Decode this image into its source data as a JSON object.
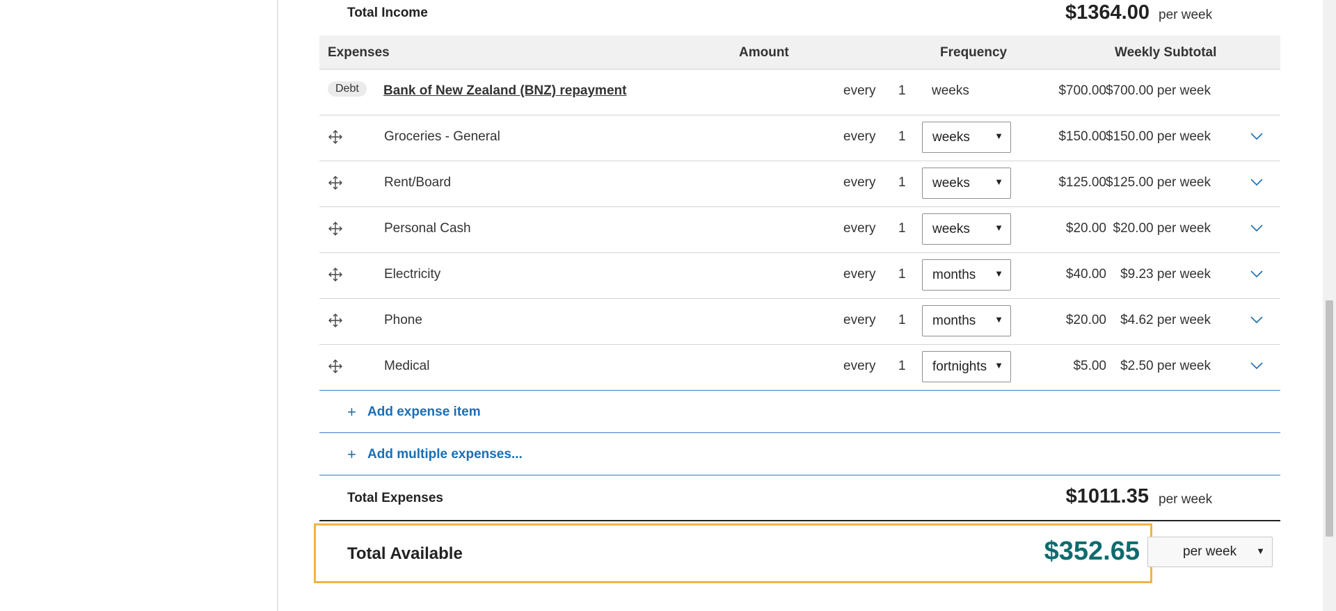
{
  "income": {
    "total_label": "Total Income",
    "total_amount": "$1364.00",
    "period": "per week"
  },
  "expenses": {
    "headers": {
      "name": "Expenses",
      "amount": "Amount",
      "frequency": "Frequency",
      "subtotal": "Weekly Subtotal"
    },
    "debt_row": {
      "badge": "Debt",
      "name": "Bank of New Zealand (BNZ) repayment",
      "amount": "$700.00",
      "every": "every",
      "count": "1",
      "unit": "weeks",
      "subtotal": "$700.00 per week"
    },
    "items": [
      {
        "name": "Groceries - General",
        "amount": "$150.00",
        "every": "every",
        "count": "1",
        "unit": "weeks",
        "subtotal": "$150.00 per week"
      },
      {
        "name": "Rent/Board",
        "amount": "$125.00",
        "every": "every",
        "count": "1",
        "unit": "weeks",
        "subtotal": "$125.00 per week"
      },
      {
        "name": "Personal Cash",
        "amount": "$20.00",
        "every": "every",
        "count": "1",
        "unit": "weeks",
        "subtotal": "$20.00 per week"
      },
      {
        "name": "Electricity",
        "amount": "$40.00",
        "every": "every",
        "count": "1",
        "unit": "months",
        "subtotal": "$9.23 per week"
      },
      {
        "name": "Phone",
        "amount": "$20.00",
        "every": "every",
        "count": "1",
        "unit": "months",
        "subtotal": "$4.62 per week"
      },
      {
        "name": "Medical",
        "amount": "$5.00",
        "every": "every",
        "count": "1",
        "unit": "fortnights",
        "subtotal": "$2.50 per week"
      }
    ],
    "add_item_label": "Add expense item",
    "add_multiple_label": "Add multiple expenses...",
    "total_label": "Total Expenses",
    "total_amount": "$1011.35",
    "period": "per week"
  },
  "available": {
    "label": "Total Available",
    "amount": "$352.65",
    "period_selected": "per week"
  },
  "colors": {
    "link": "#1a6fb5",
    "available_amount": "#0e6b6e",
    "highlight_border": "#f0b545"
  },
  "icons": {
    "move": "move-icon",
    "expand": "chevron-down-icon",
    "add": "plus-icon",
    "dropdown": "dropdown-arrow-icon"
  }
}
